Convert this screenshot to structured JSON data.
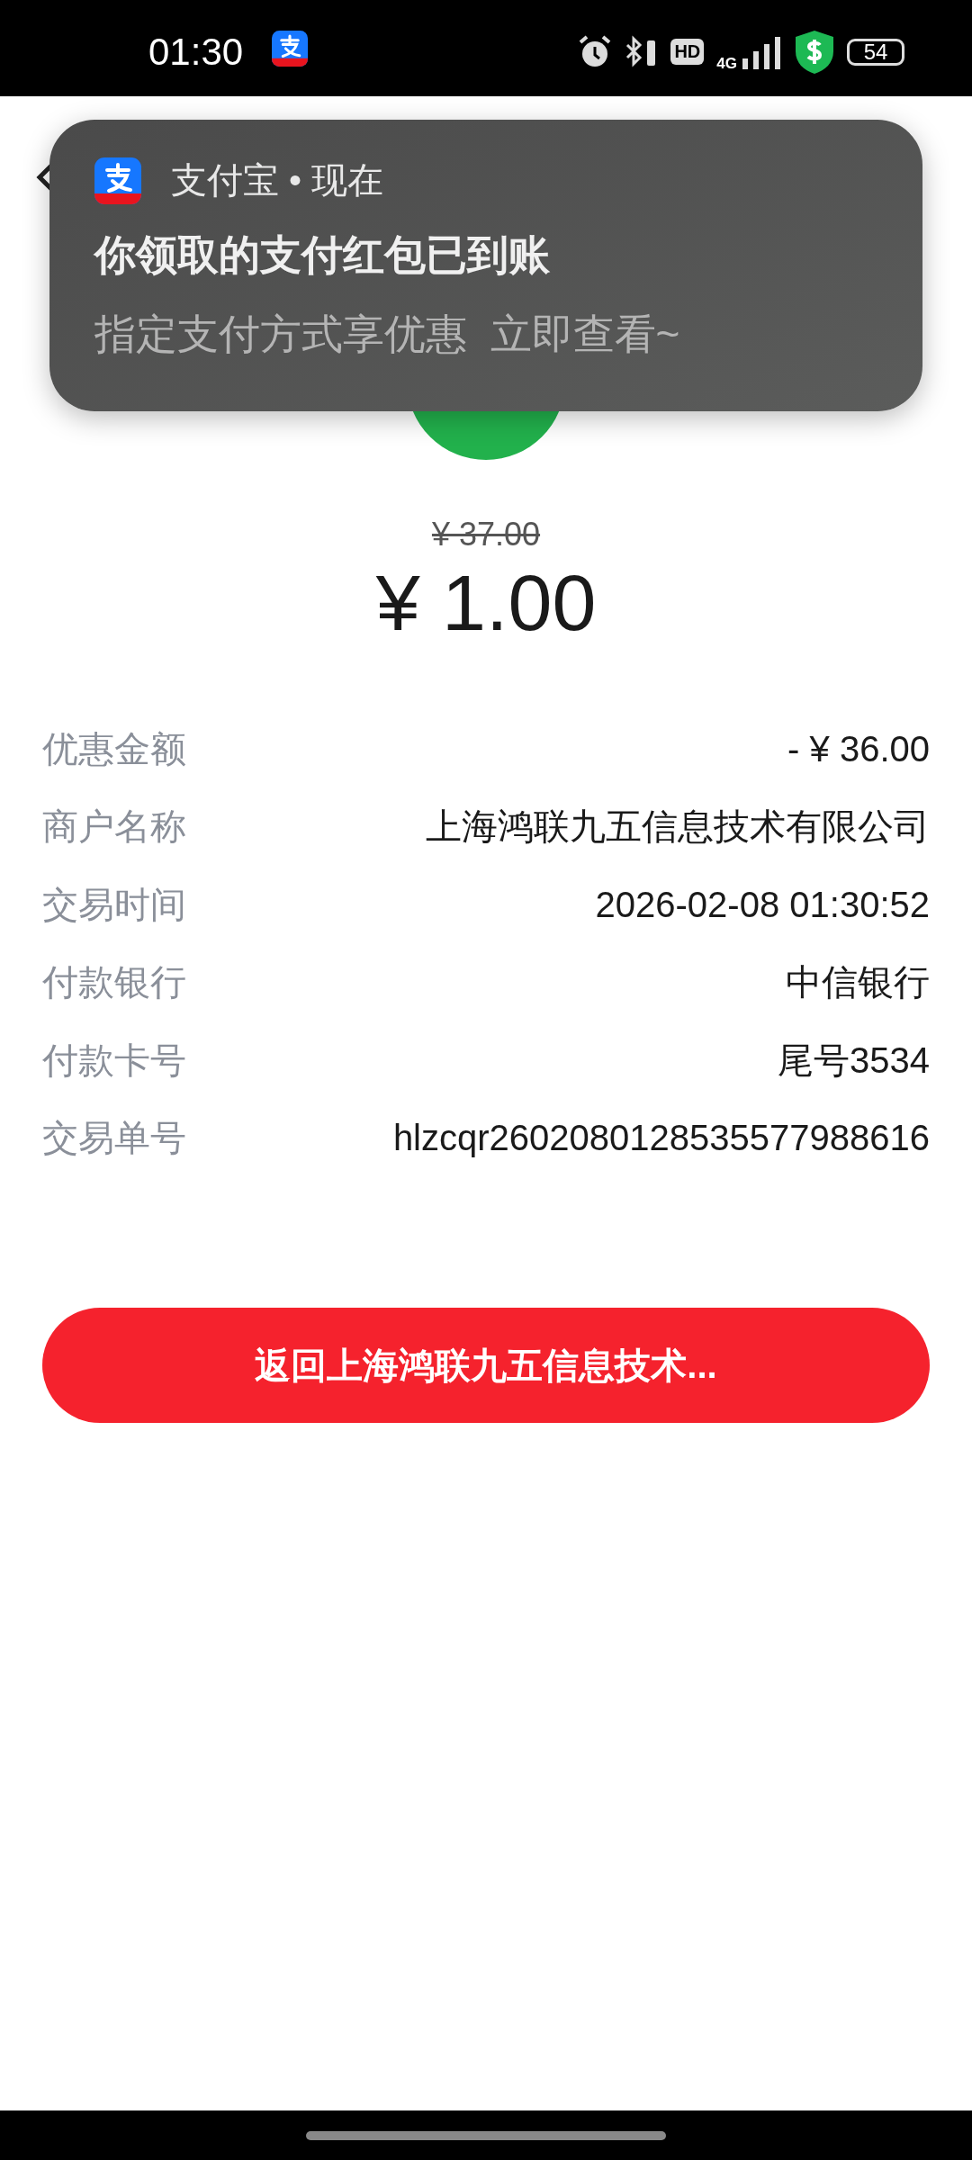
{
  "status_bar": {
    "time": "01:30",
    "hd": "HD",
    "network": "4G",
    "battery": "54"
  },
  "notification": {
    "header": "支付宝 • 现在",
    "title": "你领取的支付红包已到账",
    "body": "指定支付方式享优惠  立即查看~"
  },
  "payment": {
    "original_price": "¥ 37.00",
    "amount": "¥ 1.00"
  },
  "details": [
    {
      "label": "优惠金额",
      "value": "- ¥ 36.00"
    },
    {
      "label": "商户名称",
      "value": "上海鸿联九五信息技术有限公司"
    },
    {
      "label": "交易时间",
      "value": "2026-02-08 01:30:52"
    },
    {
      "label": "付款银行",
      "value": "中信银行"
    },
    {
      "label": "付款卡号",
      "value": "尾号3534"
    },
    {
      "label": "交易单号",
      "value": "hlzcqr2602080128535577988616"
    }
  ],
  "button": {
    "label": "返回上海鸿联九五信息技术..."
  }
}
